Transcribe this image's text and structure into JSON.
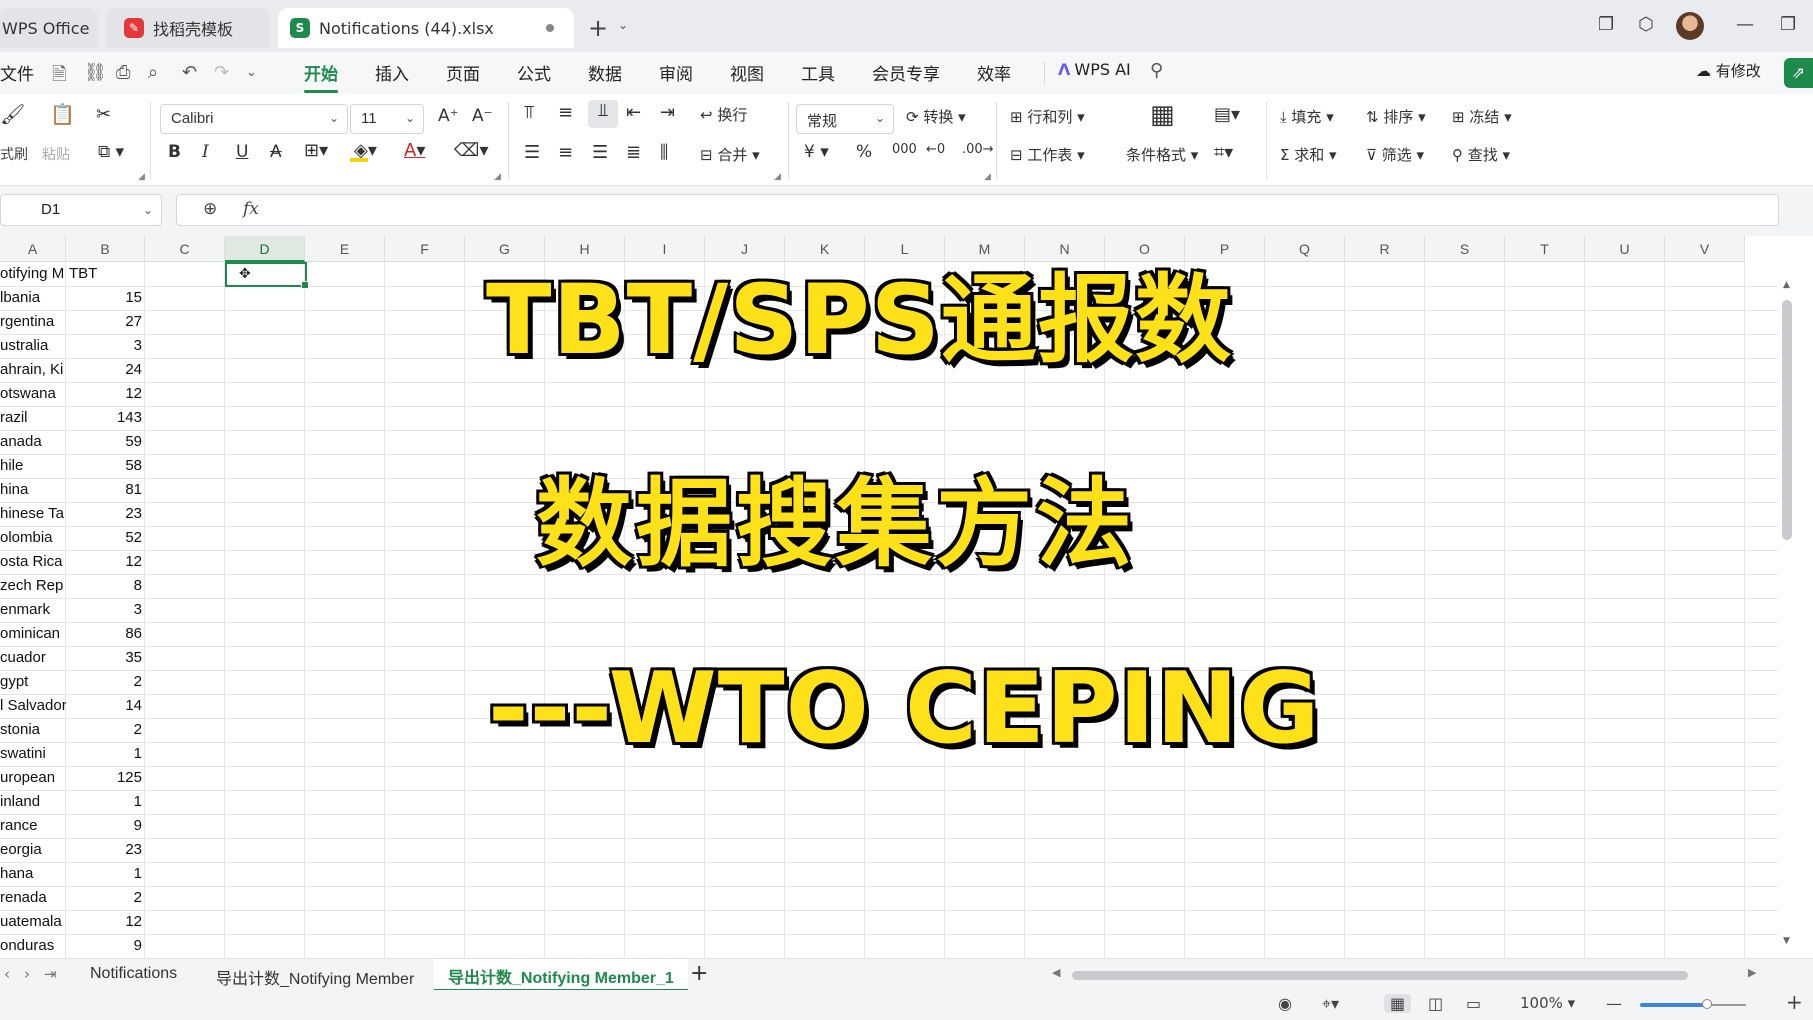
{
  "window": {
    "tabs": [
      {
        "label": "WPS Office",
        "icon": "wps-logo-icon"
      },
      {
        "label": "找稻壳模板",
        "icon": "docer-icon"
      },
      {
        "label": "Notifications (44).xlsx",
        "icon": "spreadsheet-icon",
        "active": true
      }
    ]
  },
  "menu": {
    "file": "文件",
    "items": [
      "开始",
      "插入",
      "页面",
      "公式",
      "数据",
      "审阅",
      "视图",
      "工具",
      "会员专享",
      "效率"
    ],
    "active": "开始",
    "wps_ai": "WPS AI",
    "modified": "有修改"
  },
  "ribbon": {
    "format_painter": "式刷",
    "paste": "粘贴",
    "font_name": "Calibri",
    "font_size": "11",
    "bold": "B",
    "italic": "I",
    "underline": "U",
    "wrap": "换行",
    "merge": "合并",
    "number_format": "常规",
    "convert": "转换",
    "rows_cols": "行和列",
    "worksheet": "工作表",
    "conditional_format": "条件格式",
    "fill": "填充",
    "sort": "排序",
    "freeze": "冻结",
    "sum": "求和",
    "filter": "筛选",
    "find": "查找",
    "currency_symbol": "¥",
    "percent_symbol": "%"
  },
  "formula_bar": {
    "name_box": "D1",
    "fx": "fx",
    "formula": ""
  },
  "grid": {
    "columns": [
      "A",
      "B",
      "C",
      "D",
      "E",
      "F",
      "G",
      "H",
      "I",
      "J",
      "K",
      "L",
      "M",
      "N",
      "O",
      "P",
      "Q",
      "R",
      "S",
      "T",
      "U",
      "V"
    ],
    "selected_column": "D",
    "selected_cell": "D1",
    "header_row": {
      "A": "otifying M",
      "B": "TBT"
    },
    "rows": [
      {
        "A": "lbania",
        "B": "15"
      },
      {
        "A": "rgentina",
        "B": "27"
      },
      {
        "A": "ustralia",
        "B": "3"
      },
      {
        "A": "ahrain, Ki",
        "B": "24"
      },
      {
        "A": "otswana",
        "B": "12"
      },
      {
        "A": "razil",
        "B": "143"
      },
      {
        "A": "anada",
        "B": "59"
      },
      {
        "A": "hile",
        "B": "58"
      },
      {
        "A": "hina",
        "B": "81"
      },
      {
        "A": "hinese Ta",
        "B": "23"
      },
      {
        "A": "olombia",
        "B": "52"
      },
      {
        "A": "osta Rica",
        "B": "12"
      },
      {
        "A": "zech Rep",
        "B": "8"
      },
      {
        "A": "enmark",
        "B": "3"
      },
      {
        "A": "ominican",
        "B": "86"
      },
      {
        "A": "cuador",
        "B": "35"
      },
      {
        "A": "gypt",
        "B": "2"
      },
      {
        "A": "l Salvador",
        "B": "14"
      },
      {
        "A": "stonia",
        "B": "2"
      },
      {
        "A": "swatini",
        "B": "1"
      },
      {
        "A": "uropean",
        "B": "125"
      },
      {
        "A": "inland",
        "B": "1"
      },
      {
        "A": "rance",
        "B": "9"
      },
      {
        "A": "eorgia",
        "B": "23"
      },
      {
        "A": "hana",
        "B": "1"
      },
      {
        "A": "renada",
        "B": "2"
      },
      {
        "A": "uatemala",
        "B": "12"
      },
      {
        "A": "onduras",
        "B": "9"
      }
    ]
  },
  "overlay": {
    "line1": "TBT/SPS通报数",
    "line2": "数据搜集方法",
    "line3": "---WTO CEPING",
    "fill_color": "#ffe119",
    "outline_color": "#000000"
  },
  "sheets": {
    "tabs": [
      "Notifications",
      "导出计数_Notifying Member",
      "导出计数_Notifying Member_1"
    ],
    "active": "导出计数_Notifying Member_1"
  },
  "status": {
    "zoom": "100%"
  },
  "colors": {
    "accent": "#1e8a4c"
  }
}
